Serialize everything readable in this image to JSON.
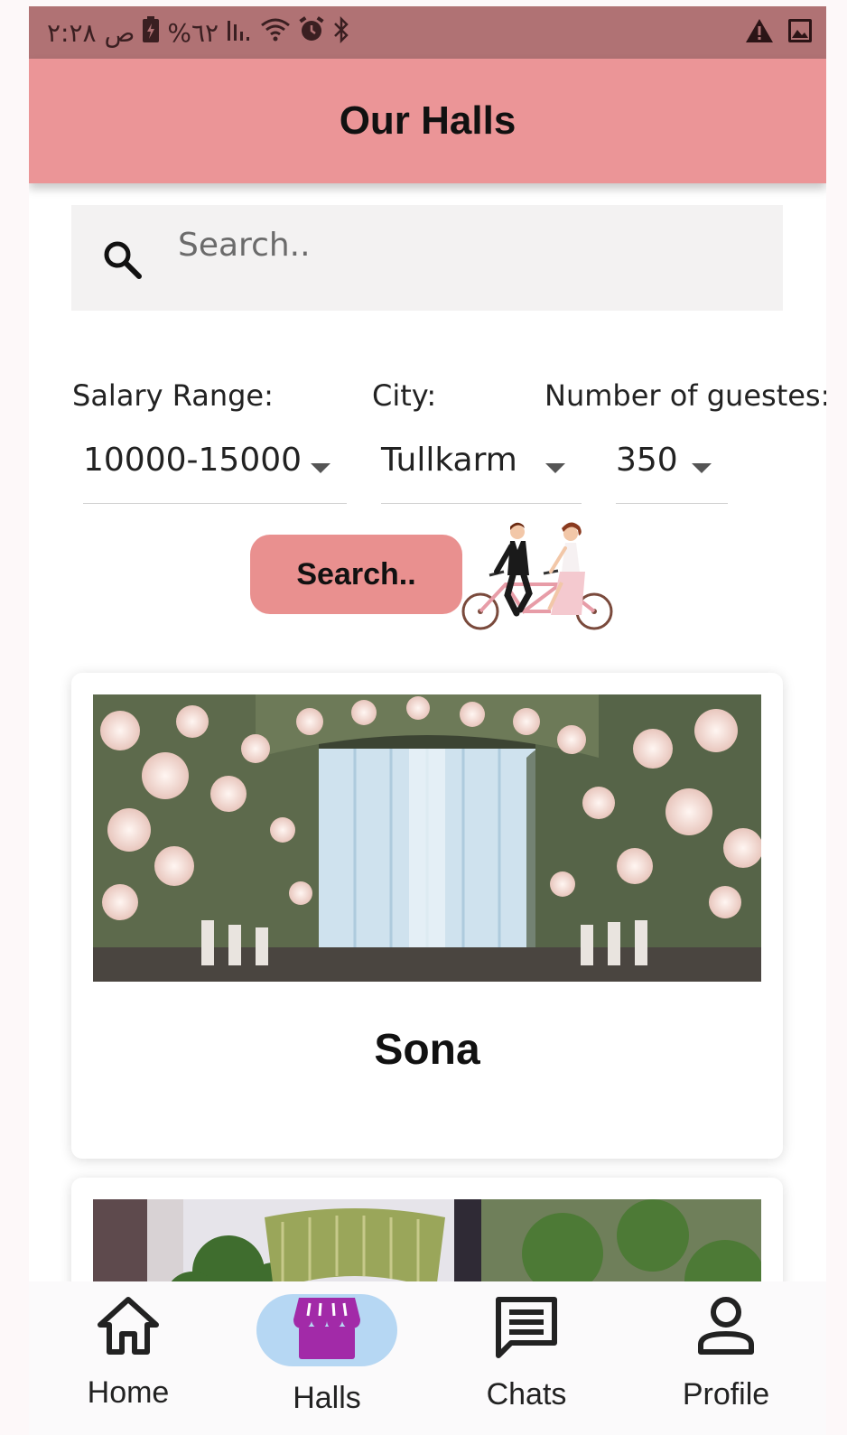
{
  "status_bar": {
    "time": "ص ٢:٢٨",
    "battery": "%٦٢",
    "icons": [
      "battery-icon",
      "signal-icon",
      "wifi-icon",
      "alarm-icon",
      "bluetooth-icon",
      "warning-icon",
      "image-icon"
    ]
  },
  "app_bar": {
    "title": "Our Halls"
  },
  "search": {
    "placeholder": "Search.."
  },
  "filters": {
    "salary": {
      "label": "Salary Range:",
      "value": "10000-15000"
    },
    "city": {
      "label": "City:",
      "value": "Tullkarm"
    },
    "guests": {
      "label": "Number of guestes:",
      "value": "350"
    }
  },
  "search_button": {
    "label": "Search.."
  },
  "halls": [
    {
      "name": "Sona"
    },
    {
      "name": ""
    }
  ],
  "bottom_nav": {
    "items": [
      {
        "label": "Home",
        "icon": "home-icon",
        "active": false
      },
      {
        "label": "Halls",
        "icon": "store-icon",
        "active": true
      },
      {
        "label": "Chats",
        "icon": "chat-icon",
        "active": false
      },
      {
        "label": "Profile",
        "icon": "person-icon",
        "active": false
      }
    ]
  },
  "colors": {
    "status_bar": "#b07274",
    "app_bar": "#eb9597",
    "button": "#e9908f",
    "active_pill": "#b6d7f3",
    "active_icon": "#a22aa8"
  }
}
